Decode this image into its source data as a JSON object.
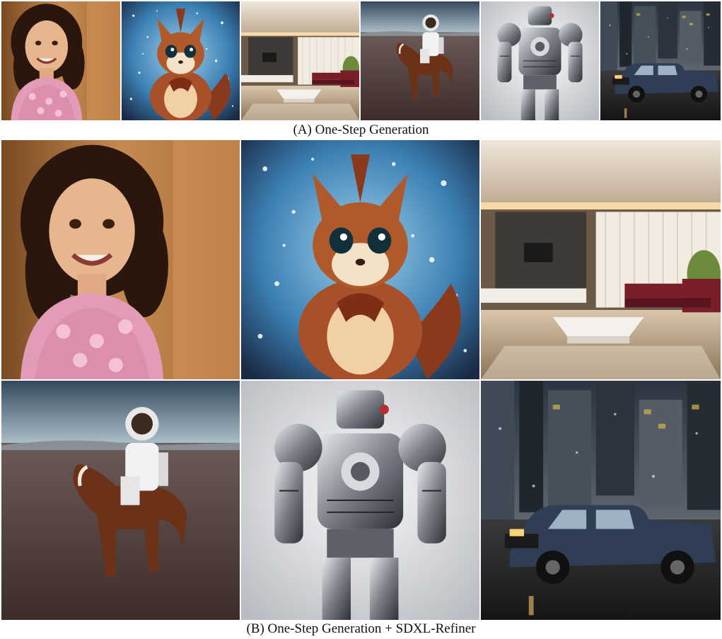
{
  "captions": {
    "top": "(A) One-Step Generation",
    "bottom": "(B) One-Step Generation + SDXL-Refiner"
  },
  "images": [
    {
      "subject": "girl-pink-dress",
      "set": "A"
    },
    {
      "subject": "squirrel-painting",
      "set": "A"
    },
    {
      "subject": "living-room",
      "set": "A"
    },
    {
      "subject": "astronaut-horse",
      "set": "A"
    },
    {
      "subject": "robot",
      "set": "A"
    },
    {
      "subject": "pickup-truck-rain",
      "set": "A"
    },
    {
      "subject": "girl-pink-dress",
      "set": "B"
    },
    {
      "subject": "squirrel-painting",
      "set": "B"
    },
    {
      "subject": "living-room",
      "set": "B"
    },
    {
      "subject": "astronaut-horse",
      "set": "B"
    },
    {
      "subject": "robot",
      "set": "B"
    },
    {
      "subject": "pickup-truck-rain",
      "set": "B"
    }
  ]
}
